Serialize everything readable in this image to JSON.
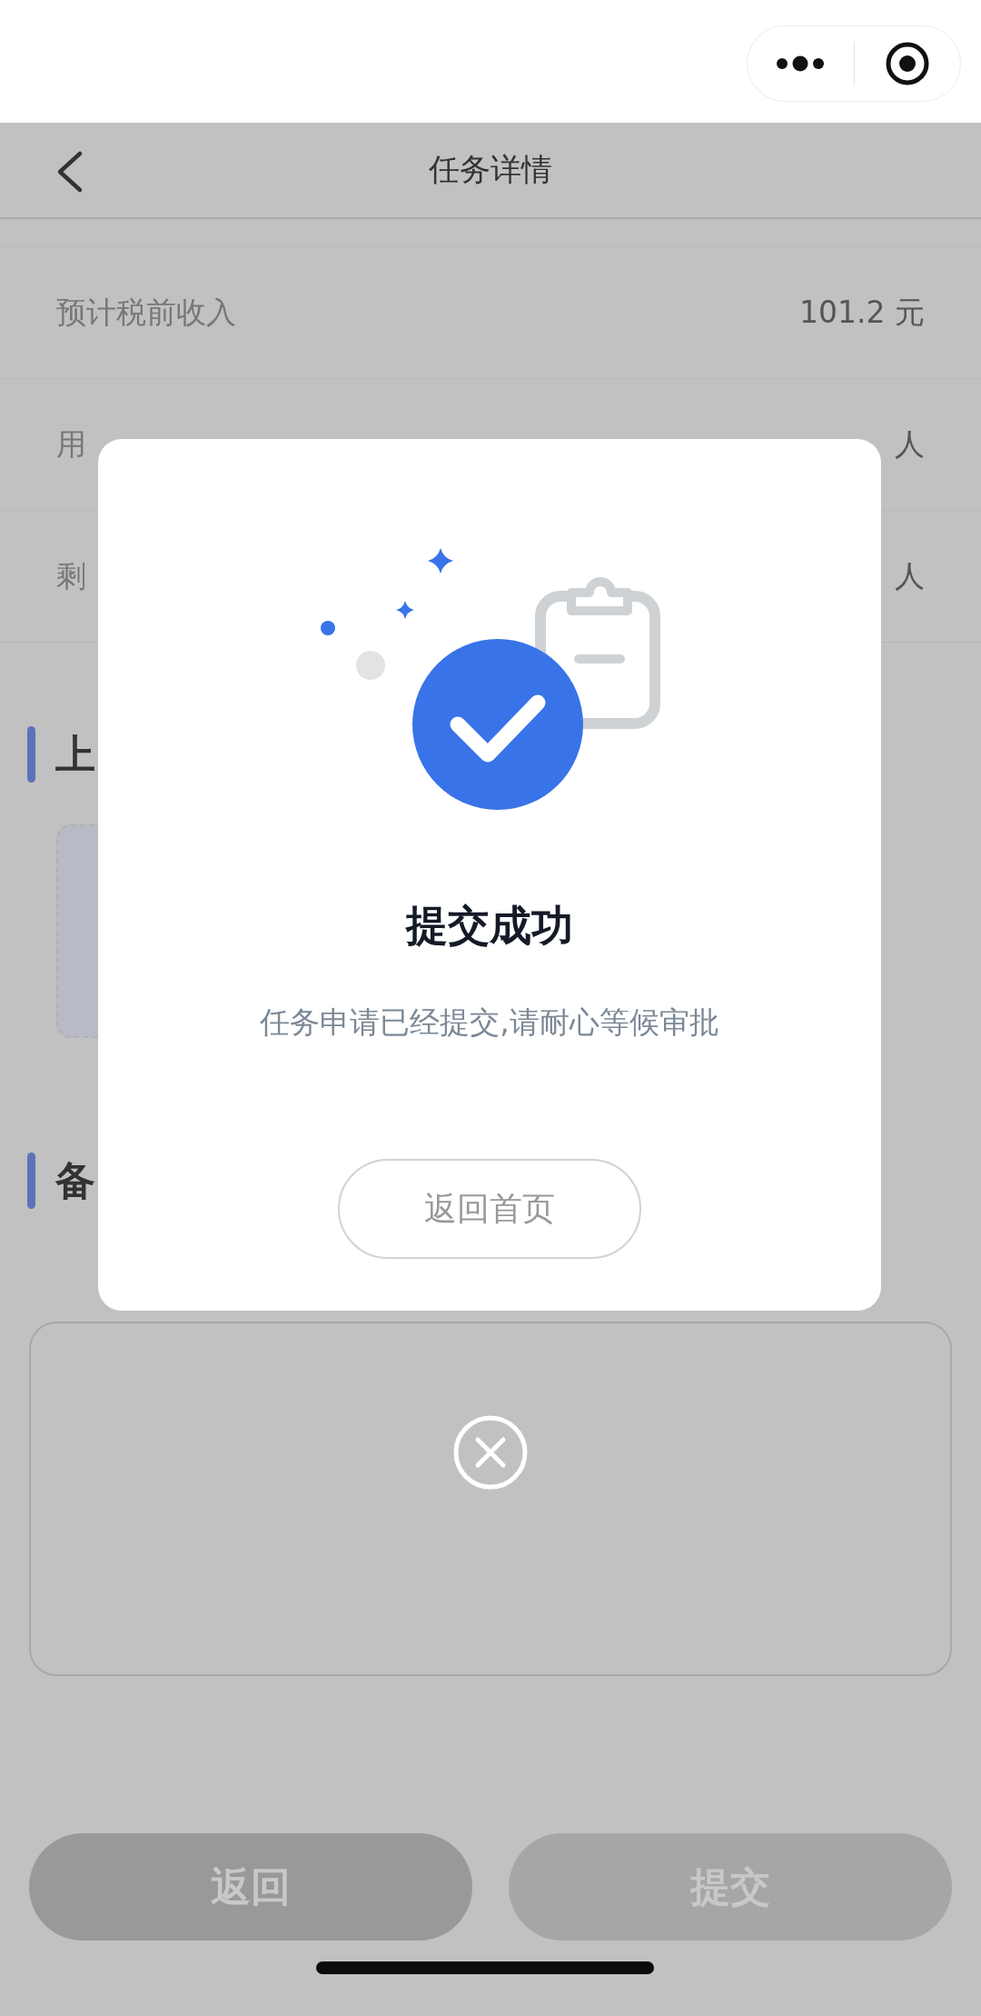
{
  "nav": {
    "title": "任务详情"
  },
  "rows": [
    {
      "label": "预计税前收入",
      "value": "101.2 元"
    },
    {
      "label": "用",
      "value": "人"
    },
    {
      "label": "剩",
      "value": "人"
    }
  ],
  "sections": [
    {
      "title": "上"
    },
    {
      "title": "备"
    }
  ],
  "buttons": [
    {
      "label": "返回",
      "kind": "secondary"
    },
    {
      "label": "提交",
      "kind": "primary"
    }
  ],
  "dialog": {
    "title": "提交成功",
    "message": "任务申请已经提交,请耐心等候审批",
    "button": "返回首页"
  }
}
